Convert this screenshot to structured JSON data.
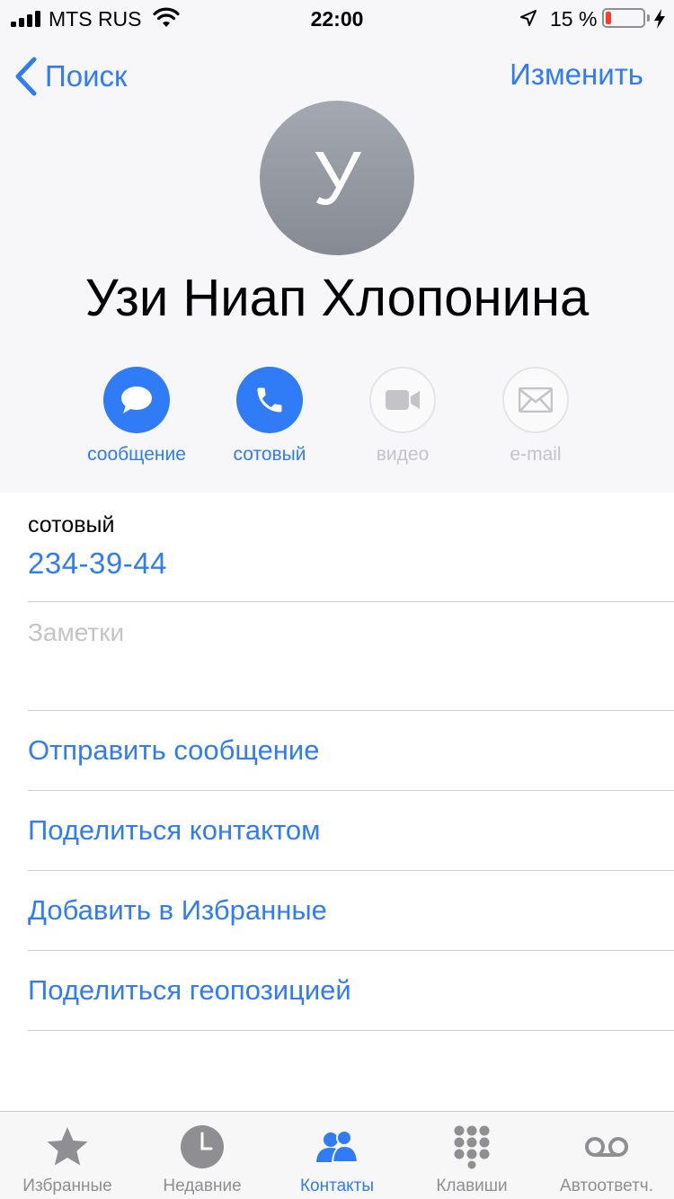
{
  "status_bar": {
    "carrier": "MTS RUS",
    "time": "22:00",
    "battery_percent": "15 %",
    "battery_level": 0.15
  },
  "nav": {
    "back_label": "Поиск",
    "edit_label": "Изменить"
  },
  "contact": {
    "initial": "У",
    "name": "Узи Ниап Хлопонина"
  },
  "actions": [
    {
      "label": "сообщение",
      "icon": "message-icon",
      "enabled": true
    },
    {
      "label": "сотовый",
      "icon": "phone-icon",
      "enabled": true
    },
    {
      "label": "видео",
      "icon": "video-icon",
      "enabled": false
    },
    {
      "label": "e-mail",
      "icon": "mail-icon",
      "enabled": false
    }
  ],
  "phone": {
    "label": "сотовый",
    "number": "234-39-44"
  },
  "notes_label": "Заметки",
  "links": [
    "Отправить сообщение",
    "Поделиться контактом",
    "Добавить в Избранные",
    "Поделиться геопозицией"
  ],
  "tabs": [
    {
      "label": "Избранные",
      "icon": "star-icon",
      "active": false
    },
    {
      "label": "Недавние",
      "icon": "clock-icon",
      "active": false
    },
    {
      "label": "Контакты",
      "icon": "contacts-icon",
      "active": true
    },
    {
      "label": "Клавиши",
      "icon": "keypad-icon",
      "active": false
    },
    {
      "label": "Автоответч.",
      "icon": "voicemail-icon",
      "active": false
    }
  ],
  "colors": {
    "accent": "#2f7cf6",
    "battery_low": "#ff3b30",
    "disabled": "#c4c4c8",
    "header_bg": "#f7f7fa"
  }
}
